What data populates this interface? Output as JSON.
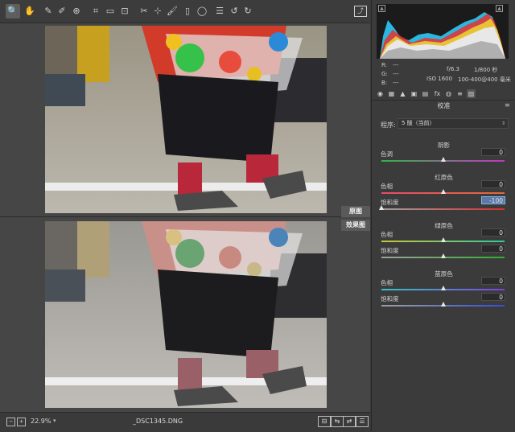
{
  "colors": {
    "selection": "#5a7aa8",
    "track_shadows_tint": [
      "#33b24a",
      "#c038c0"
    ],
    "track_red_hue": [
      "#e84c6a",
      "#e06a3a"
    ],
    "track_red_sat": [
      "#a0a0a0",
      "#d83030"
    ],
    "track_green_hue": [
      "#c8c830",
      "#30c8a0"
    ],
    "track_green_sat": [
      "#a0a0a0",
      "#30b030"
    ],
    "track_blue_hue": [
      "#30c8c8",
      "#8040e0"
    ],
    "track_blue_sat": [
      "#a0a0a0",
      "#3050d8"
    ]
  },
  "toolbar": {
    "icons": [
      "zoom-icon",
      "hand-icon",
      "white-balance-icon",
      "color-sampler-icon",
      "targeted-adjust-icon",
      "crop-icon",
      "straighten-icon",
      "transform-icon",
      "spot-removal-icon",
      "red-eye-icon",
      "adjustment-brush-icon",
      "graduated-filter-icon",
      "radial-filter-icon",
      "preferences-icon",
      "rotate-left-icon",
      "rotate-right-icon"
    ],
    "glyphs": [
      "🔍",
      "✋",
      "✎",
      "✐",
      "⊕",
      "⌗",
      "▭",
      "⊡",
      "✂",
      "⊹",
      "🖌",
      "▯",
      "◯",
      "☰",
      "↺",
      "↻"
    ],
    "open_icon": "⤴"
  },
  "canvas": {
    "tag_before": "原图",
    "tag_after": "效果图"
  },
  "status": {
    "zoom": "22.9%",
    "zoom_caret": "▾",
    "minus": "−",
    "plus": "+",
    "filename": "_DSC1345.DNG",
    "view_buttons": [
      "⊟",
      "⇆",
      "⇄",
      "☰"
    ]
  },
  "panel": {
    "histogram": {
      "clip_shadow": "▲",
      "clip_highlight": "▲"
    },
    "info": {
      "r_label": "R:",
      "r_val": "---",
      "g_label": "G:",
      "g_val": "---",
      "b_label": "B:",
      "b_val": "---",
      "aperture": "f/6.3",
      "shutter": "1/800 秒",
      "iso": "ISO 1600",
      "lens": "100-400@400 毫米"
    },
    "tabs": [
      "◉",
      "▦",
      "▲",
      "▣",
      "▤",
      "fx",
      "◍",
      "≡",
      "▨"
    ],
    "section_title": "校准",
    "menu_icon": "≡",
    "process_label": "程序:",
    "process_value": "5 版（当前）",
    "process_caret": "⇕",
    "groups": {
      "shadows": {
        "title": "阴影",
        "rows": [
          {
            "label": "色调",
            "value": "0",
            "pos": 0.5
          }
        ]
      },
      "red": {
        "title": "红原色",
        "rows": [
          {
            "label": "色相",
            "value": "0",
            "pos": 0.5
          },
          {
            "label": "饱和度",
            "value": "-100",
            "pos": 0.0
          }
        ]
      },
      "green": {
        "title": "绿原色",
        "rows": [
          {
            "label": "色相",
            "value": "0",
            "pos": 0.5
          },
          {
            "label": "饱和度",
            "value": "0",
            "pos": 0.5
          }
        ]
      },
      "blue": {
        "title": "蓝原色",
        "rows": [
          {
            "label": "色相",
            "value": "0",
            "pos": 0.5
          },
          {
            "label": "饱和度",
            "value": "0",
            "pos": 0.5
          }
        ]
      }
    }
  }
}
